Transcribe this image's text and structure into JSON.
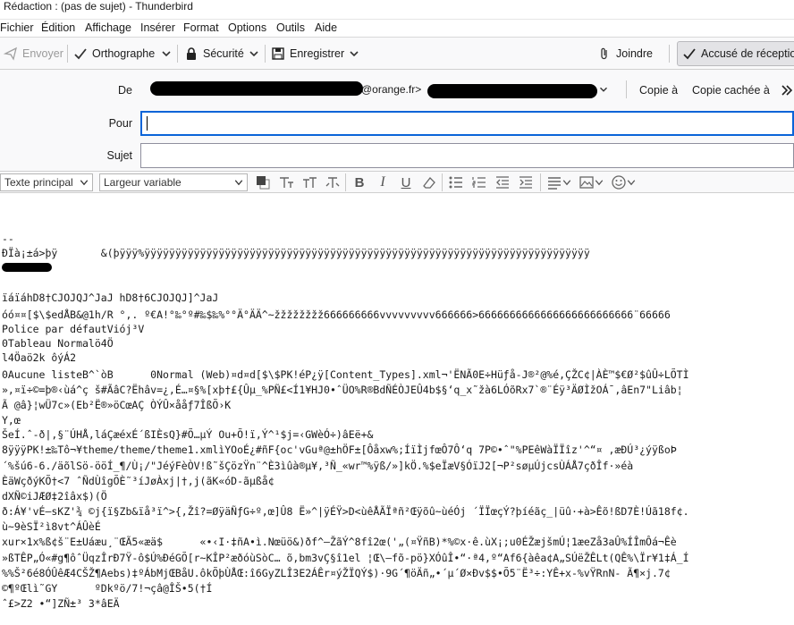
{
  "window": {
    "title": "Rédaction : (pas de sujet) - Thunderbird"
  },
  "menu": {
    "items": [
      {
        "label": "Fichier"
      },
      {
        "label": "Édition"
      },
      {
        "label": "Affichage"
      },
      {
        "label": "Insérer"
      },
      {
        "label": "Format"
      },
      {
        "label": "Options"
      },
      {
        "label": "Outils"
      },
      {
        "label": "Aide"
      }
    ]
  },
  "toolbar": {
    "send": "Envoyer",
    "spelling": "Orthographe",
    "security": "Sécurité",
    "save": "Enregistrer",
    "attach": "Joindre",
    "receipt": "Accusé de réception"
  },
  "headers": {
    "from_label": "De",
    "from_value_visible": "@orange.fr>",
    "cc": "Copie à",
    "bcc": "Copie cachée à",
    "to_label": "Pour",
    "to_value": "",
    "subject_label": "Sujet",
    "subject_value": ""
  },
  "format": {
    "paragraph_style": "Texte principal",
    "font": "Largeur variable"
  },
  "colors": {
    "focus": "#0a64d8",
    "redaction": "#000000"
  },
  "body_lines": [
    "--",
    "ÐÏà¡±á>þÿ       &(þÿÿÿ%ÿÿÿÿÿÿÿÿÿÿÿÿÿÿÿÿÿÿÿÿÿÿÿÿÿÿÿÿÿÿÿÿÿÿÿÿÿÿÿÿÿÿÿÿÿÿÿÿÿÿÿÿÿÿÿÿÿÿÿÿÿÿÿÿÿÿÿÿÿÿÿÿ",
    "",
    "",
    "ïáïáhD8†CJOJQJ^JaJ hD8†6CJOJQJ]^JaJ",
    "óó¤¤[$\\$edÅB&@1h/R °,. º€A!°‰°º#‰$‰%°°Ä°ÄÄ^~žžžžžžžž666666666vvvvvvvvv666666>6666666666666666666666666¨66666",
    "Police par défautViój³V",
    "0Tableau Normalö4Ö",
    "l4Öaö2k ôýÁ2",
    "0Aucune listeB^`òB      0Normal (Web)¤d¤d[$\\$PK!éP¿ÿ[Content_Types].xml¬'ËNÃ0E÷Hüƒå-J®²@%é,ÇŽC¢|ÀÈ™$€Ø²$ûÛ÷LÕTÌ",
    "»,¤ï÷©=þ®‹ùá^ç š#ÃâC?Ëhâv=¿,É…¤§%[xþ†£{Ûµ_%PÑ£<Í1¥HJ0•ˆÜO%R®BdÑÉÒJEÛ4b$§‘q_x˜žà6LÓõRx7`®¨Éÿ³ÄØÌžOÁ¯,âEn7\"Liâb¦",
    "Ã @â}¦wÜ7c»(Eb²Ë®»öCœAÇ ÒÝÛ×ååƒ7ÎßÕ›K",
    "Y,œ",
    "ŠeÍ.ˆ-ð|,§¨ÚHÅ,láÇæéxÉ´ßIÈsQ}#Õ…µÝ Ou+Õ!ï,Ý^¹$j=‹GWèÓ÷)âEë+&",
    "8ÿÿÿPK!±‰Tô¬¥theme/theme/theme1.xmlìYOoÉ¿#ñF{oc'vGuª@±hÖF±[Ôåxw%;ÍïÌjfœÔ7Ô‘q 7P©•ˆ\"%PEêWàÏÏîz'^“¤ ,æÐÚ³¿ýÿßoÞ",
    "´%šú6-6./äõlSö-ööÍ_¶/Ù¡/\"JéýFèÒV!ß˜šÇözŸn¨^È3ìûà®µ¥,³Ñ_«wr™%ÿß/»]kÖ.%$eÏæV§ÓïJ2[¬P²søµÚjcsÙÁÅ7çðÎf·»éà",
    "ÈäWçðýKÕ†<7 ˆÑdÙîgÕÈ˜³íJøÀxj|†,j(ãK«óD-ãµßå¢",
    "dXÑ©iJÆØ‡2îâx$)(Ö",
    "ð:Á¥'vÉ—sKZ'¾ ©j{ï§Zb&ïå³ï^>{,Žî?=ØÿäÑƒG÷º,œ]Û8 Ë»^|ÿÉŸ>D<ùêÅÃÏªñ²Œÿõû~ùéÓj ´ÏÏœçÝ?þíéãç_|üû·+à>Êõ!ßD7È!Úã18f¢.",
    "ù~9èSÏ²ì8vt^ÁÛèÉ",
    "xur×1x%ß¢š¨E±Uáæu¸¨ŒÃ5«æä$      «•‹I·‡ñA•ì.Nœüö&)ðf^–ŽãÝ^8fî2œ('„(¤ŸñB)*%©x·ê.ùX¡;u0ÉŽæjšmÚ¦1æeZå3aÛ%ÍÎmÔá¬Êè",
    "»ßTÊP„Ó«#g¶ôˆÜqzÎrÐ7Ÿ-ô$Ú%ÐéGÕ[r~KÎP²æðóùSòC… õ,bm3vÇ§î1el ¦Œ\\—fõ-pö}XÓûÎ•“·ª4,º“Af6{àêa¢A„SÚëŽÊLt(QÊ%\\Ïr¥1‡Á_Í",
    "%%Š²6é8ÓÛêÆ4CŠŽ¶Aebs)‡ºÁbMjŒBåU.ôkÕþÙÅŒ:î6GyZLÎ3E2ÁÊr¤ýŽÏQÝ$)·9G´¶öÄñ„•´µ´Ø×Ðv$$•Õ5¨Ë³÷:YÊ+x-%vŸRnN- Ã¶×j.7¢",
    "©¶ºŒlì˜GY      ºDkºö/7!¬çâ@ÎŠ•5(†Í",
    "ˆ£>Z2 •“]ZÑ±³ 3*âEÄ"
  ]
}
